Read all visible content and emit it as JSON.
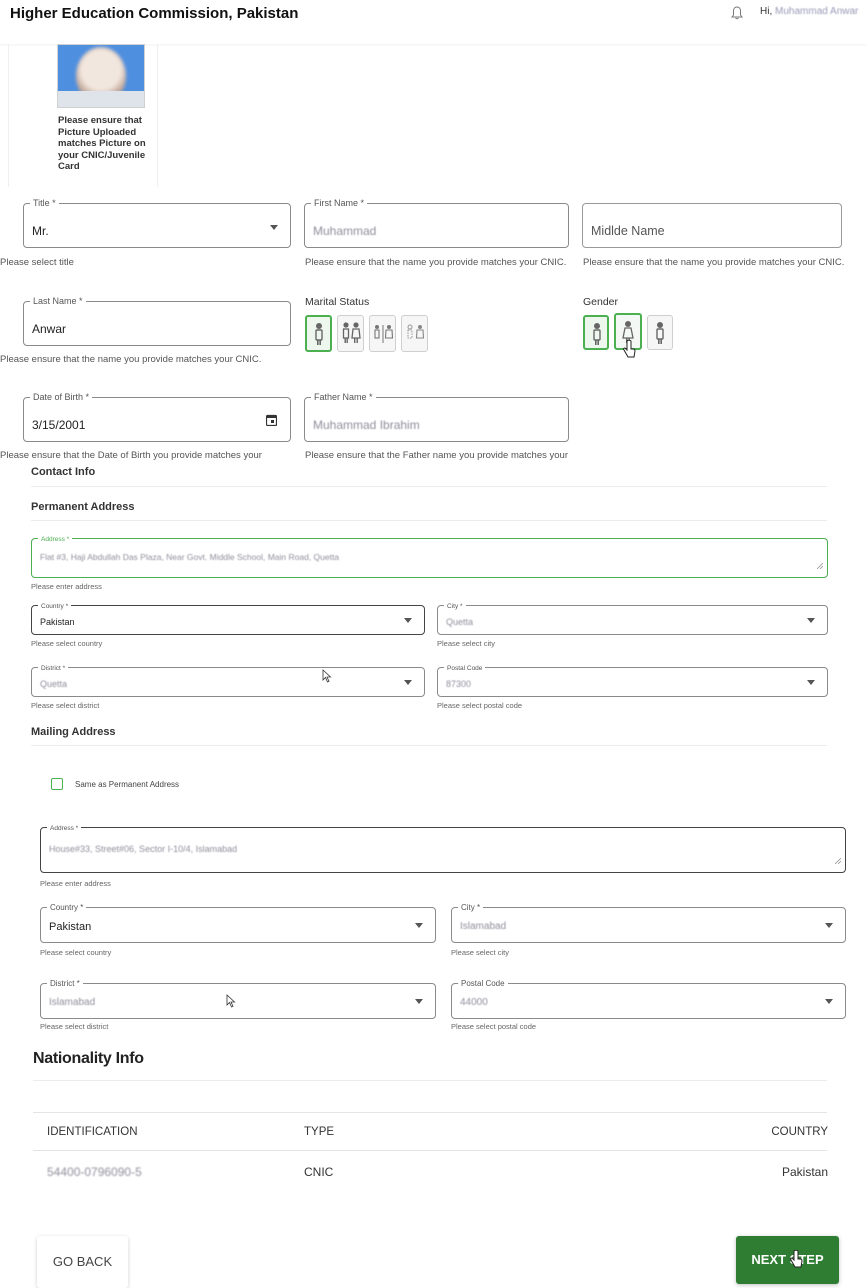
{
  "header": {
    "title": "Higher Education Commission, Pakistan",
    "greeting": "Hi,",
    "user_name": "Muhammad Anwar"
  },
  "photo": {
    "note": "Please ensure that Picture Uploaded matches Picture on your CNIC/Juvenile Card"
  },
  "personal": {
    "title": {
      "label": "Title *",
      "value": "Mr.",
      "helper": "Please select title"
    },
    "first_name": {
      "label": "First Name *",
      "value": "Muhammad",
      "helper": "Please ensure that the name you provide matches your CNIC."
    },
    "middle_name": {
      "placeholder": "Midlde Name",
      "helper": "Please ensure that the name you provide matches your CNIC."
    },
    "last_name": {
      "label": "Last Name *",
      "value": "Anwar",
      "helper": "Please ensure that the name you provide matches your CNIC."
    },
    "marital_status": {
      "label": "Marital Status",
      "options": [
        "single-icon",
        "married-icon",
        "divorced-icon",
        "widowed-icon"
      ],
      "selected": 0
    },
    "gender": {
      "label": "Gender",
      "options": [
        "male-icon",
        "female-icon",
        "other-icon"
      ],
      "selected": 0
    },
    "dob": {
      "label": "Date of Birth *",
      "value": "3/15/2001",
      "helper": "Please ensure that the Date of Birth you provide matches your"
    },
    "father_name": {
      "label": "Father Name *",
      "value": "Muhammad Ibrahim",
      "helper": "Please ensure that the Father name you provide matches your"
    }
  },
  "contact": {
    "heading": "Contact Info",
    "permanent": {
      "heading": "Permanent Address",
      "address": {
        "label": "Address *",
        "value": "Flat #3, Haji Abdullah Das Plaza, Near Govt. Middle School, Main Road, Quetta",
        "helper": "Please enter address"
      },
      "country": {
        "label": "Country *",
        "value": "Pakistan",
        "helper": "Please select country"
      },
      "city": {
        "label": "City *",
        "value": "Quetta",
        "helper": "Please select city"
      },
      "district": {
        "label": "District *",
        "value": "Quetta",
        "helper": "Please select district"
      },
      "postal": {
        "label": "Postal Code",
        "value": "87300",
        "helper": "Please select postal code"
      }
    },
    "mailing": {
      "heading": "Mailing Address",
      "same_as": "Same as Permanent Address",
      "address": {
        "label": "Address *",
        "value": "House#33, Street#06, Sector I-10/4, Islamabad",
        "helper": "Please enter address"
      },
      "country": {
        "label": "Country *",
        "value": "Pakistan",
        "helper": "Please select country"
      },
      "city": {
        "label": "City *",
        "value": "Islamabad",
        "helper": "Please select city"
      },
      "district": {
        "label": "District *",
        "value": "Islamabad",
        "helper": "Please select district"
      },
      "postal": {
        "label": "Postal Code",
        "value": "44000",
        "helper": "Please select postal code"
      }
    }
  },
  "nationality": {
    "heading": "Nationality Info",
    "columns": [
      "IDENTIFICATION",
      "TYPE",
      "COUNTRY"
    ],
    "rows": [
      {
        "identification": "54400-0796090-5",
        "type": "CNIC",
        "country": "Pakistan"
      }
    ]
  },
  "actions": {
    "back": "GO BACK",
    "next": "NEXT STEP"
  },
  "colors": {
    "accent": "#4caf50",
    "primary_button": "#2e7d32"
  }
}
